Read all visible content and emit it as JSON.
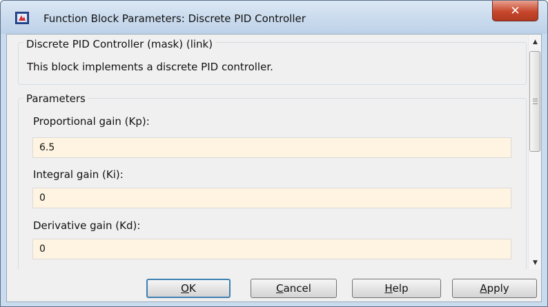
{
  "window": {
    "title": "Function Block Parameters: Discrete PID Controller",
    "close_glyph": "✕",
    "app_icon": "simulink-block-icon"
  },
  "mask_group": {
    "legend": "Discrete PID Controller (mask) (link)",
    "description": "This block implements a discrete PID controller."
  },
  "parameters": {
    "legend": "Parameters",
    "fields": [
      {
        "label": "Proportional gain (Kp):",
        "value": "6.5"
      },
      {
        "label": "Integral gain (Ki):",
        "value": "0"
      },
      {
        "label": "Derivative gain (Kd):",
        "value": "0"
      }
    ]
  },
  "scrollbar": {
    "up_glyph": "▲",
    "down_glyph": "▼"
  },
  "buttons": {
    "ok": {
      "mnemonic": "O",
      "rest": "K"
    },
    "cancel": {
      "mnemonic": "C",
      "rest": "ancel"
    },
    "help": {
      "mnemonic": "H",
      "rest": "elp"
    },
    "apply": {
      "mnemonic": "A",
      "rest": "pply"
    }
  },
  "colors": {
    "input_bg": "#fff4e1",
    "close_red": "#c7472c",
    "default_button_border": "#3c7fb1"
  }
}
